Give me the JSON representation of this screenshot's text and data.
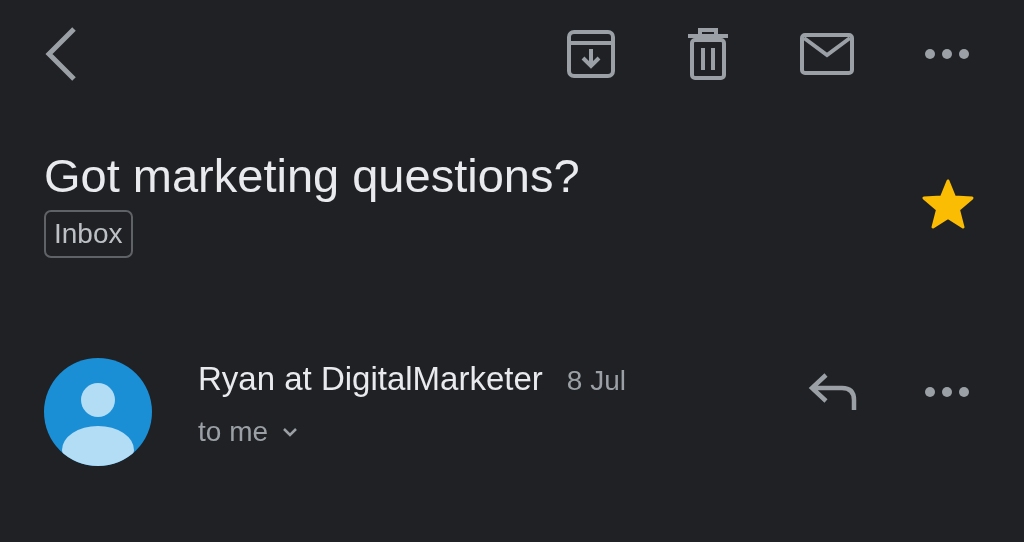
{
  "subject": "Got marketing questions?",
  "labels": [
    "Inbox"
  ],
  "starred": true,
  "message": {
    "sender": "Ryan at DigitalMarketer",
    "date": "8 Jul",
    "recipient": "to me"
  }
}
